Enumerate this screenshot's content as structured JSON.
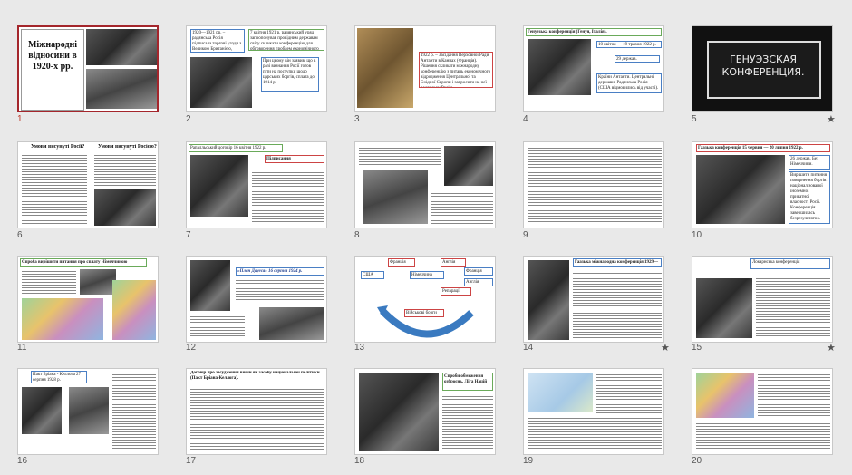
{
  "slides": [
    {
      "num": "1",
      "title": "Міжнародні відносини в 1920-х рр.",
      "selected": true
    },
    {
      "num": "2",
      "t1": "1920—1921 рр. – радянська Росія підписала торгові угоди з Великою Британією, Німеччиною.",
      "t2": "7 квітня 1921 р. радянський уряд запропонував провідним державам світу скликати конференцію для обговорення проблем економічного співробітництва.",
      "t3": "При цьому він заявив, що в разі визнання Росії готов піти на поступки щодо царських боргів, сплата до 1914 р."
    },
    {
      "num": "3",
      "t1": "1922 р. – Засідання Верховної Ради Антанти в Каннах (Франція). Рішення скликати міжнародну конференцію з питань економічного відродження Центральної та Східної Європи і запросити на неї радянську Росію."
    },
    {
      "num": "4",
      "title": "Генуезька конференція (Генуя, Італія).",
      "d1": "10 квітня — 19 травня 1922 р.",
      "d2": "29 держав.",
      "t1": "Країни Антанти. Центральні держави. Радянська Росія (США відмовились від участі)."
    },
    {
      "num": "5",
      "caption": "ГЕНУЭЗСКАЯ КОНФЕРЕНЦИЯ.",
      "star": "★"
    },
    {
      "num": "6",
      "h1": "Умови висунуті Росії?",
      "h2": "Умови висунуті Росією?"
    },
    {
      "num": "7",
      "title": "Рапалльський договір 16 квітня 1922 р.",
      "label": "Підписання"
    },
    {
      "num": "8"
    },
    {
      "num": "9"
    },
    {
      "num": "10",
      "title": "Гаазька конференція 15 червня — 20 липня 1922 р.",
      "t1": "26 держав. Без Німеччини.",
      "t2": "Вирішити питання повернення боргів і націоналізованої іноземної приватної власності Росії. Конференція завершилась безрезультатно."
    },
    {
      "num": "11",
      "title": "Спроба вирішити питання про сплату Німеччиною репарацій"
    },
    {
      "num": "12",
      "title": "«План Дауеса» 16 серпня 1924 р."
    },
    {
      "num": "13",
      "n1": "Франція",
      "n2": "США",
      "n3": "Німеччина",
      "n4": "Англія",
      "n5": "Репарації",
      "n6": "Франція",
      "n7": "Англія",
      "n8": "Військові борги"
    },
    {
      "num": "14",
      "title": "Гаазька міжнародна конференція 1929—1930 рр.",
      "star": "★"
    },
    {
      "num": "15",
      "title": "Локарнська конференція",
      "star": "★"
    },
    {
      "num": "16",
      "t1": "Пакт Бріана - Келлога 27 серпня 1928 р."
    },
    {
      "num": "17",
      "title": "Договір про засудження війни як засобу національної політики (Пакт Бріана-Келлога)."
    },
    {
      "num": "18",
      "t1": "Спроби обмеження озброєнь. Ліга Націй"
    },
    {
      "num": "19"
    },
    {
      "num": "20"
    }
  ]
}
